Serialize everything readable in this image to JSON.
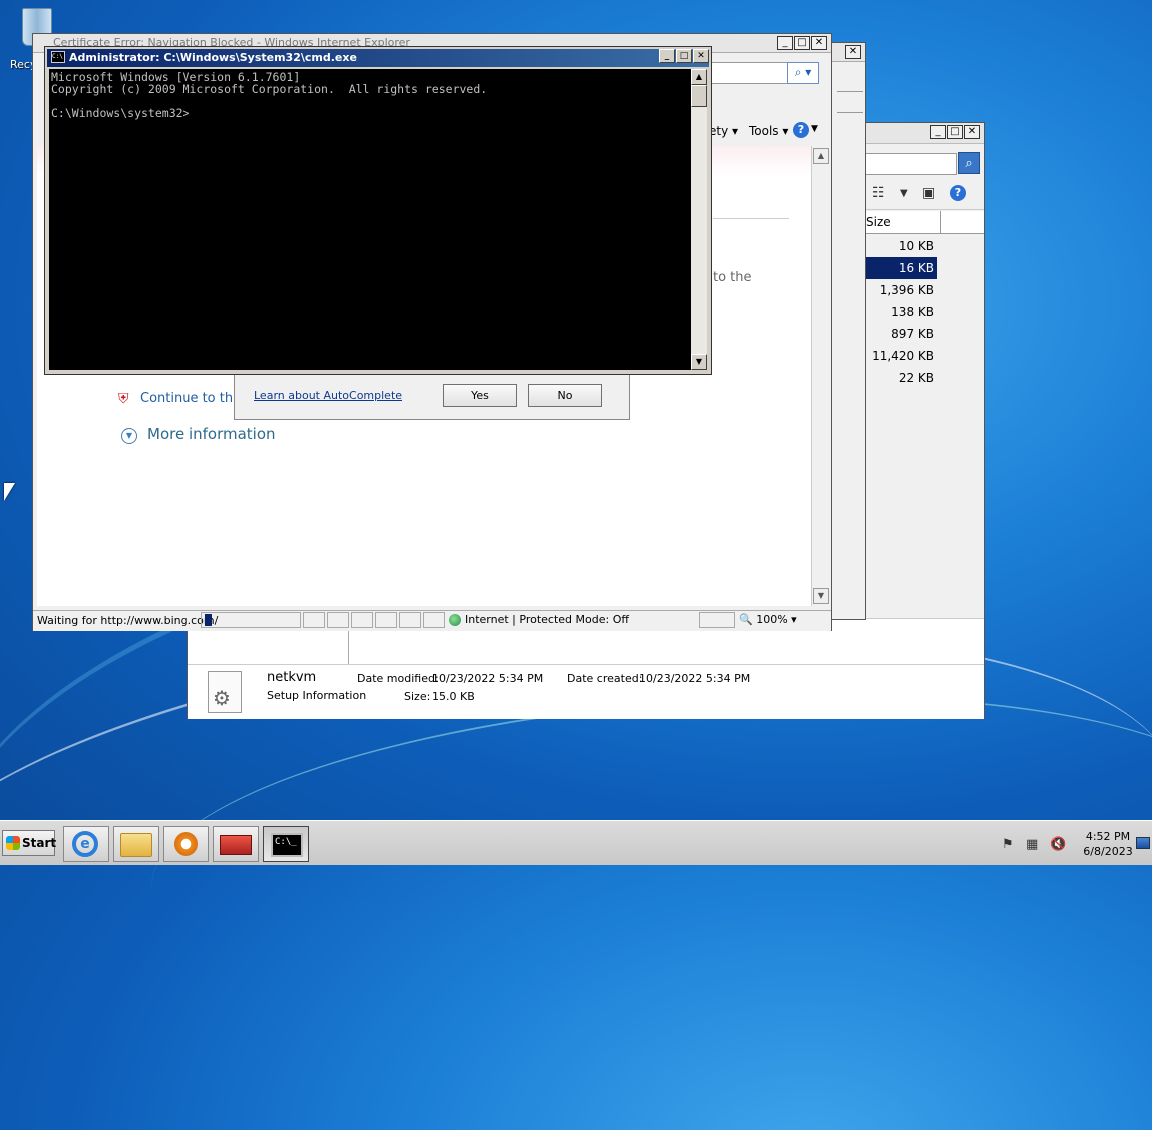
{
  "desktop": {
    "recycle_label": "Recy",
    "accent_color": "#1c7fd6"
  },
  "explorer": {
    "size_header": "Size",
    "file_sizes": [
      "10 KB",
      "16 KB",
      "1,396 KB",
      "138 KB",
      "897 KB",
      "11,420 KB",
      "22 KB"
    ],
    "selected_index": 1,
    "details": {
      "name": "netkvm",
      "type": "Setup Information",
      "modified_label": "Date modified:",
      "modified_value": "10/23/2022 5:34 PM",
      "created_label": "Date created:",
      "created_value": "10/23/2022 5:34 PM",
      "size_label": "Size:",
      "size_value": "15.0 KB"
    }
  },
  "ie": {
    "title_partial": "Certificate Error: Navigation Blocked - Windows Internet Explorer",
    "cmd_safety": "ety ▾",
    "cmd_tools": "Tools ▾",
    "content_fragment": "to the",
    "continue_label": "Continue to this",
    "more_info_label": "More information",
    "status_text": "Waiting for http://www.bing.com/",
    "zone_text": "Internet | Protected Mode: Off",
    "zoom_text": "100%"
  },
  "autocomplete": {
    "learn_link": "Learn about AutoComplete",
    "yes_label": "Yes",
    "no_label": "No"
  },
  "cmd": {
    "title": "Administrator: C:\\Windows\\System32\\cmd.exe",
    "console_text": "Microsoft Windows [Version 6.1.7601]\nCopyright (c) 2009 Microsoft Corporation.  All rights reserved.\n\nC:\\Windows\\system32>"
  },
  "taskbar": {
    "start_label": "Start",
    "time": "4:52 PM",
    "date": "6/8/2023",
    "cmd_icon_text": "C:\\_"
  }
}
